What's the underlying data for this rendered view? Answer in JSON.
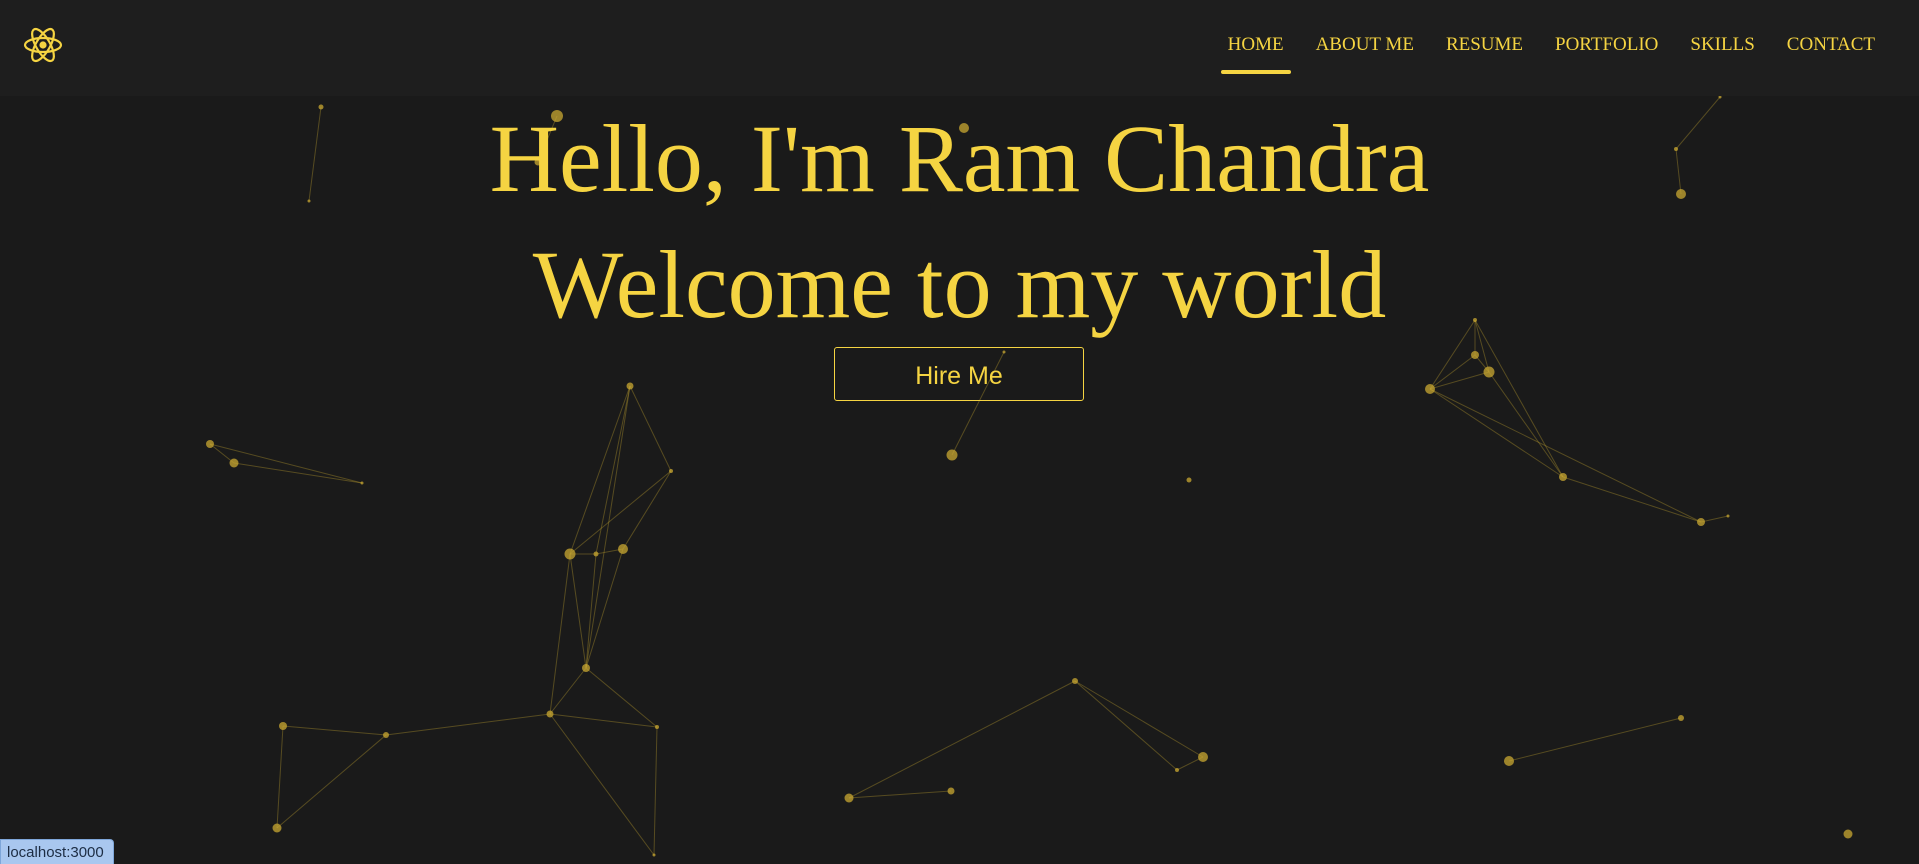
{
  "nav": {
    "logo_icon": "react-atom-icon",
    "items": [
      {
        "label": "HOME",
        "active": true
      },
      {
        "label": "ABOUT ME",
        "active": false
      },
      {
        "label": "RESUME",
        "active": false
      },
      {
        "label": "PORTFOLIO",
        "active": false
      },
      {
        "label": "SKILLS",
        "active": false
      },
      {
        "label": "CONTACT",
        "active": false
      }
    ]
  },
  "hero": {
    "line1": "Hello, I'm Ram Chandra",
    "line2": "Welcome to my world",
    "button_label": "Hire Me"
  },
  "status_bar": {
    "url": "localhost:3000"
  },
  "colors": {
    "background": "#1a1a1a",
    "navbar": "#1e1e1e",
    "accent": "#f5d442"
  }
}
